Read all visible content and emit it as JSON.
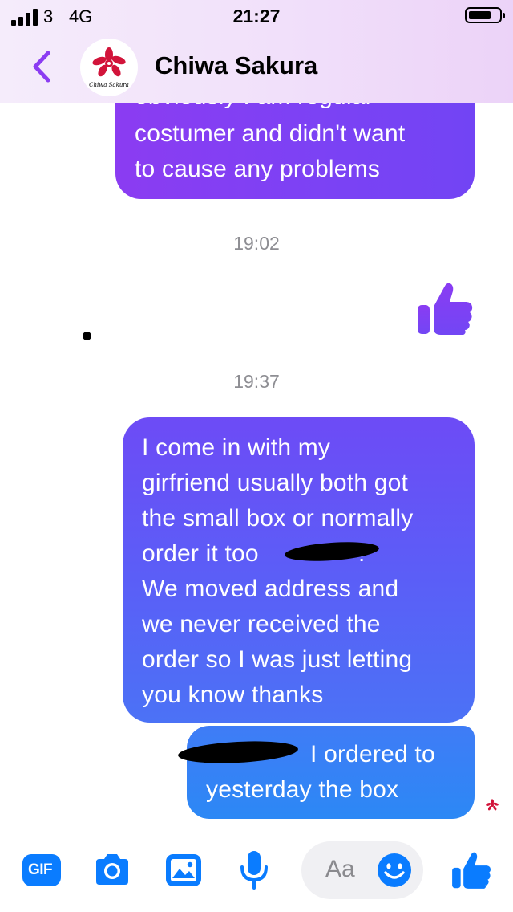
{
  "status_bar": {
    "carrier": "3",
    "network": "4G",
    "time": "21:27",
    "battery_level": 0.75
  },
  "header": {
    "contact_name": "Chiwa Sakura",
    "avatar_caption": "Chiwa Sakura",
    "icons": [
      "back-chevron-icon",
      "cherry-blossom-logo"
    ]
  },
  "messages": {
    "first_partial": {
      "lines": [
        "obviously I am regular",
        "costumer and didn't want",
        "to cause any problems"
      ]
    },
    "ts1": "19:02",
    "ts2": "19:37",
    "second": {
      "lines": [
        "I come in with my",
        "girfriend usually both got",
        "the small box or normally",
        "order it too",
        "We moved address and",
        "we never received the",
        "order so I was just letting",
        "you know thanks"
      ],
      "line4_end": "!"
    },
    "third": {
      "line1": "I ordered to",
      "line2": "yesterday the box"
    }
  },
  "composer": {
    "gif_label": "GIF",
    "placeholder": "Aa",
    "icons": [
      "gif-icon",
      "camera-icon",
      "image-icon",
      "microphone-icon",
      "emoji-icon",
      "thumbs-up-icon"
    ]
  },
  "colors": {
    "accent": "#0a7cff",
    "purple": "#8b3cf2",
    "header_gradient_end": "#ecd3f8",
    "timestamp": "#8e8e93"
  }
}
